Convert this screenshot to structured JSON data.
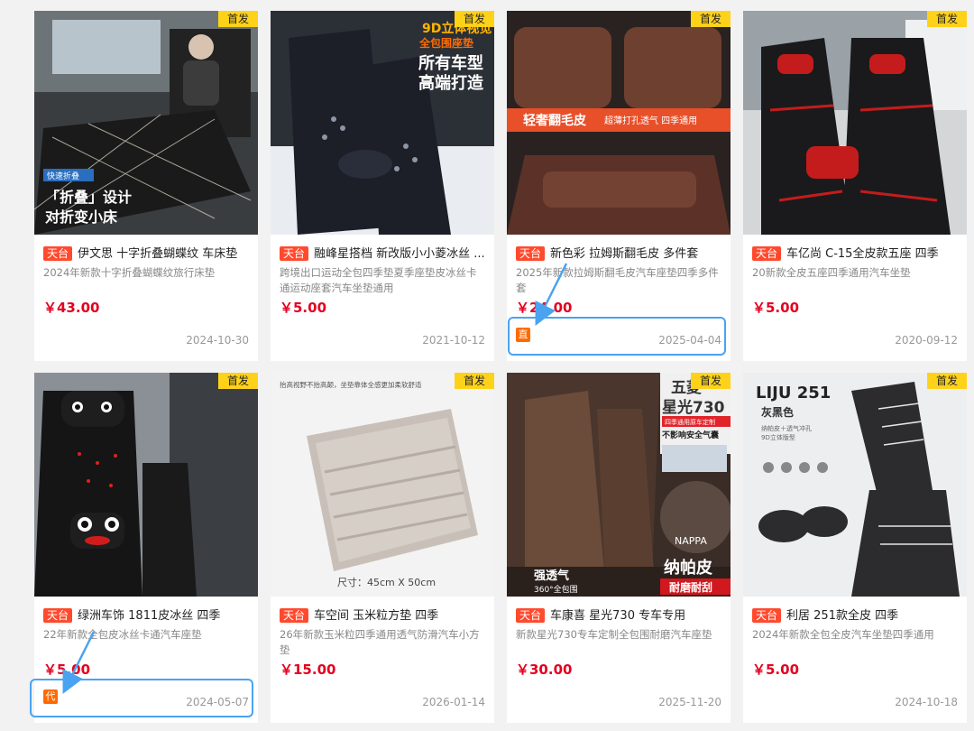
{
  "products": [
    {
      "badge": "首发",
      "shop": "天台",
      "title": "伊文思 十字折叠蝴蝶纹 车床垫",
      "desc": "2024年新款十字折叠蝴蝶纹旅行床垫",
      "price": "￥43.00",
      "date": "2024-10-30",
      "img_text": [
        "快速折叠",
        "「折叠」设计",
        "对折变小床"
      ]
    },
    {
      "badge": "首发",
      "shop": "天台",
      "title": "融峰星搭档 新改版小小菱冰丝 ...",
      "desc": "跨境出口运动全包四季垫夏季座垫皮冰丝卡通运动座套汽车坐垫通用",
      "price": "￥5.00",
      "date": "2021-10-12",
      "img_text": [
        "9D立体视觉",
        "全包围座垫",
        "所有车型",
        "高端打造"
      ]
    },
    {
      "badge": "首发",
      "shop": "天台",
      "title": "新色彩 拉姆斯翻毛皮 多件套",
      "desc": "2025年新款拉姆斯翻毛皮汽车座垫四季多件套",
      "price": "￥24.00",
      "date": "2025-04-04",
      "tag": "直",
      "img_text": [
        "轻奢翻毛皮",
        "超薄打孔透气 四季通用"
      ]
    },
    {
      "badge": "首发",
      "shop": "天台",
      "title": "车亿尚 C-15全皮款五座 四季",
      "desc": "20新款全皮五座四季通用汽车坐垫",
      "price": "￥5.00",
      "date": "2020-09-12",
      "img_text": []
    },
    {
      "badge": "首发",
      "shop": "天台",
      "title": "绿洲车饰 1811皮冰丝 四季",
      "desc": "22年新款全包皮冰丝卡通汽车座垫",
      "price": "￥5.00",
      "date": "2024-05-07",
      "tag": "代",
      "img_text": []
    },
    {
      "badge": "首发",
      "shop": "天台",
      "title": "车空间 玉米粒方垫 四季",
      "desc": "26年新款玉米粒四季通用透气防滑汽车小方垫",
      "price": "￥15.00",
      "date": "2026-01-14",
      "img_text": [
        "抬高视野不抬高颠，坐垫靠体全感更加柔软舒适",
        "尺寸：45cm X 50cm"
      ]
    },
    {
      "badge": "首发",
      "shop": "天台",
      "title": "车康喜 星光730 专车专用",
      "desc": "新款星光730专车定制全包围耐磨汽车座垫",
      "price": "￥30.00",
      "date": "2025-11-20",
      "img_text": [
        "五菱",
        "星光730",
        "四季通用原车定制",
        "不影响安全气囊",
        "NAPPA",
        "强透气",
        "360°全包围",
        "纳帕皮",
        "耐磨耐刮"
      ]
    },
    {
      "badge": "首发",
      "shop": "天台",
      "title": "利居 251款全皮 四季",
      "desc": "2024年新款全包全皮汽车坐垫四季通用",
      "price": "￥5.00",
      "date": "2024-10-18",
      "img_text": [
        "LIJU 251",
        "灰黑色",
        "纳帕皮＋透气冲孔",
        "9D立体版型"
      ]
    }
  ]
}
